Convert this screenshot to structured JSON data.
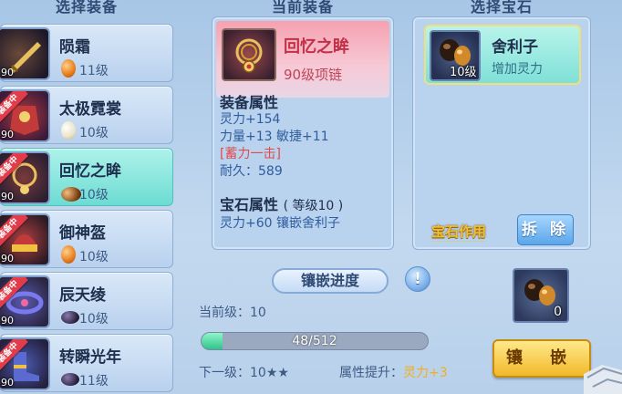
{
  "equip_list": {
    "title": "选择装备",
    "items": [
      {
        "name": "陨霜",
        "level": "90",
        "gem_level": "11级",
        "gem": "amber",
        "equipped": false,
        "icon": "sword-icon"
      },
      {
        "name": "太极霓裳",
        "level": "90",
        "gem_level": "10级",
        "gem": "pearl",
        "equipped": true,
        "icon": "armor-icon"
      },
      {
        "name": "回忆之眸",
        "level": "90",
        "gem_level": "10级",
        "gem": "sarira",
        "equipped": true,
        "icon": "necklace-icon",
        "selected": true
      },
      {
        "name": "御神盔",
        "level": "90",
        "gem_level": "10级",
        "gem": "amber",
        "equipped": true,
        "icon": "helmet-icon"
      },
      {
        "name": "辰天绫",
        "level": "90",
        "gem_level": "10级",
        "gem": "dark",
        "equipped": true,
        "icon": "belt-icon"
      },
      {
        "name": "转瞬光年",
        "level": "90",
        "gem_level": "11级",
        "gem": "dark",
        "equipped": true,
        "icon": "boots-icon"
      }
    ],
    "equipped_badge": "装备中"
  },
  "current_equip": {
    "title": "当前装备",
    "name": "回忆之眸",
    "subtitle": "90级项链",
    "attr_heading": "装备属性",
    "attrs": [
      "灵力+154",
      "力量+13 敏捷+11"
    ],
    "special": "[蓄力一击]",
    "durability": "耐久：589",
    "gem_heading": "宝石属性",
    "gem_level_note": "( 等级10 )",
    "gem_effect": "灵力+60 镶嵌舍利子"
  },
  "gem_select": {
    "title": "选择宝石",
    "gem_name": "舍利子",
    "gem_desc": "增加灵力",
    "gem_level": "10级",
    "effect_label": "宝石作用",
    "remove_label": "拆 除"
  },
  "progress": {
    "banner": "镶嵌进度",
    "help": "!",
    "current_level": "当前级：10",
    "value_text": "48/512",
    "fraction": 0.09375,
    "next_level": "下一级：10★★",
    "boost_label": "属性提升：",
    "boost_value": "灵力+3"
  },
  "slot": {
    "count": "0"
  },
  "inlay_button": "镶 嵌"
}
